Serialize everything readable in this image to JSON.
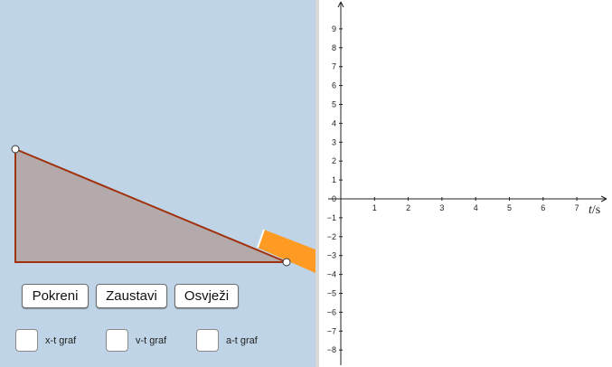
{
  "buttons": {
    "start": "Pokreni",
    "stop": "Zaustavi",
    "refresh": "Osvježi"
  },
  "checkboxes": [
    {
      "label": "x-t graf",
      "checked": false
    },
    {
      "label": "v-t graf",
      "checked": false
    },
    {
      "label": "a-t graf",
      "checked": false
    }
  ],
  "colors": {
    "panel_background": "#bfd4e6",
    "incline_fill": "#b4aaab",
    "incline_edge": "#a0330e",
    "block": "#ff9a22"
  },
  "graph": {
    "x_axis_label_var": "t",
    "x_axis_label_unit": "s",
    "x_ticks": [
      "1",
      "2",
      "3",
      "4",
      "5",
      "6",
      "7"
    ],
    "y_ticks": [
      "9",
      "8",
      "7",
      "6",
      "5",
      "4",
      "3",
      "2",
      "1",
      "0",
      "−1",
      "−2",
      "−3",
      "−4",
      "−5",
      "−6",
      "−7",
      "−8"
    ]
  }
}
